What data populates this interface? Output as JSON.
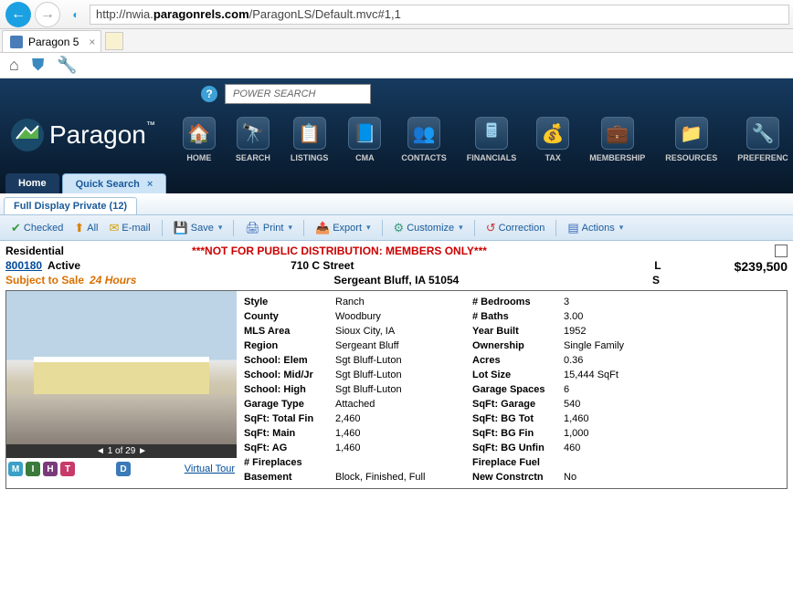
{
  "browser": {
    "url_pre": "http://nwia.",
    "url_bold": "paragonrels.com",
    "url_post": "/ParagonLS/Default.mvc#1,1",
    "tab_title": "Paragon 5"
  },
  "header": {
    "power_search": "POWER SEARCH",
    "logo": "Paragon",
    "nav": [
      {
        "label": "HOME",
        "icon": "🏠",
        "id": "home"
      },
      {
        "label": "SEARCH",
        "icon": "🔭",
        "id": "search"
      },
      {
        "label": "LISTINGS",
        "icon": "📋",
        "id": "listings"
      },
      {
        "label": "CMA",
        "icon": "📘",
        "id": "cma"
      },
      {
        "label": "CONTACTS",
        "icon": "👥",
        "id": "contacts"
      },
      {
        "label": "FINANCIALS",
        "icon": "🖩",
        "id": "financials"
      },
      {
        "label": "TAX",
        "icon": "💰",
        "id": "tax"
      },
      {
        "label": "MEMBERSHIP",
        "icon": "💼",
        "id": "membership"
      },
      {
        "label": "RESOURCES",
        "icon": "📁",
        "id": "resources"
      },
      {
        "label": "PREFERENC",
        "icon": "🔧",
        "id": "preferences"
      }
    ]
  },
  "tabs": {
    "home": "Home",
    "quick": "Quick Search"
  },
  "subtab": "Full Display Private (12)",
  "toolbar": {
    "checked": "Checked",
    "all": "All",
    "email": "E-mail",
    "save": "Save",
    "print": "Print",
    "export": "Export",
    "customize": "Customize",
    "correction": "Correction",
    "actions": "Actions"
  },
  "content": {
    "category": "Residential",
    "warning": "***NOT FOR PUBLIC DISTRIBUTION: MEMBERS ONLY***",
    "mls": "800180",
    "status": "Active",
    "address": "710 C Street",
    "l_label": "L",
    "price": "$239,500",
    "subject": "Subject to Sale",
    "hours": "24 Hours",
    "city": "Sergeant Bluff, IA 51054",
    "s_label": "S",
    "pager": "◄ 1 of 29 ►",
    "virtual_tour": "Virtual Tour"
  },
  "details_left_labels": [
    "Style",
    "County",
    "MLS Area",
    "Region",
    "School: Elem",
    "School: Mid/Jr",
    "School: High",
    "Garage Type",
    "SqFt: Total Fin",
    "SqFt: Main",
    "SqFt: AG",
    "# Fireplaces",
    "Basement"
  ],
  "details_left_values": [
    "Ranch",
    "Woodbury",
    "Sioux City, IA",
    "Sergeant Bluff",
    "Sgt Bluff-Luton",
    "Sgt Bluff-Luton",
    "Sgt Bluff-Luton",
    "Attached",
    "2,460",
    "1,460",
    "1,460",
    "",
    "Block, Finished, Full"
  ],
  "details_right_labels": [
    "# Bedrooms",
    "# Baths",
    "Year Built",
    "Ownership",
    "Acres",
    "Lot Size",
    "Garage Spaces",
    "SqFt: Garage",
    "SqFt: BG Tot",
    "SqFt: BG Fin",
    "SqFt: BG Unfin",
    "Fireplace Fuel",
    "New Constrctn"
  ],
  "details_right_values": [
    "3",
    "3.00",
    "1952",
    "Single Family",
    "0.36",
    "15,444 SqFt",
    "6",
    "540",
    "1,460",
    "1,000",
    "460",
    "",
    "No"
  ]
}
